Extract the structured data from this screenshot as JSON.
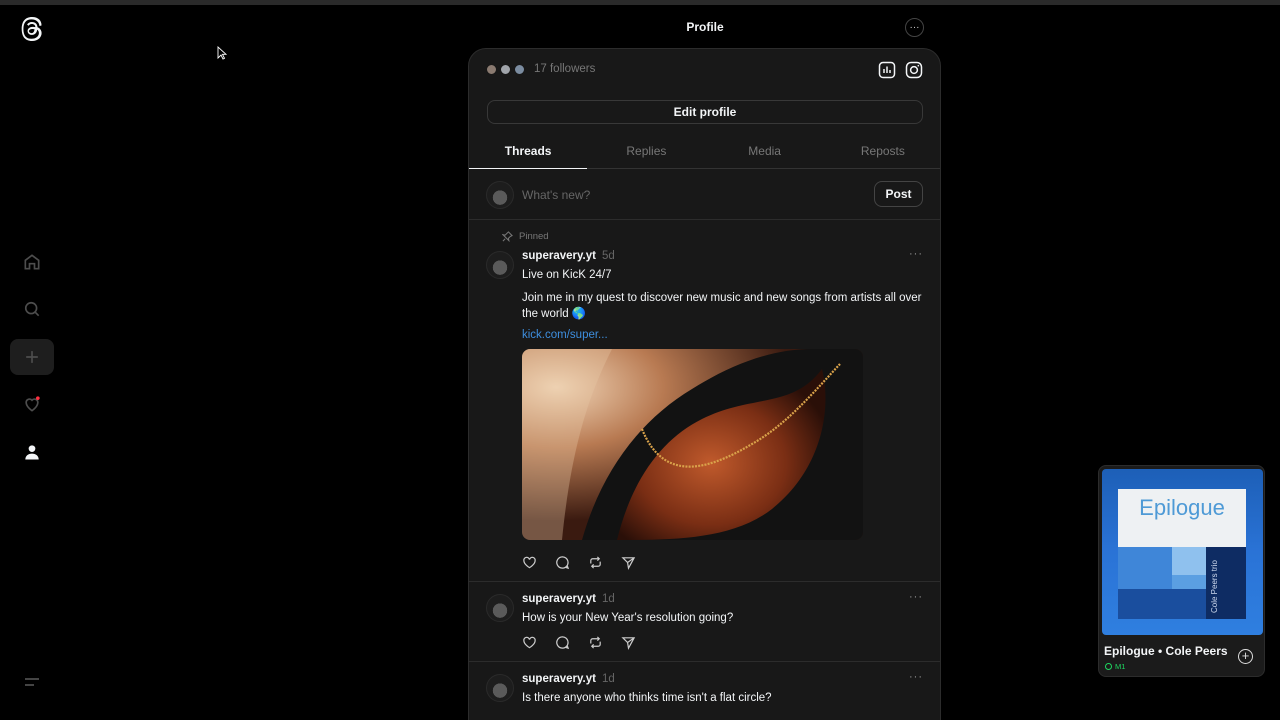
{
  "header": {
    "title": "Profile",
    "more_icon": "more-horizontal-icon",
    "more_label": "···"
  },
  "nav": {
    "logo_icon": "threads-logo-icon",
    "items": [
      {
        "name": "home",
        "icon": "home-icon"
      },
      {
        "name": "search",
        "icon": "search-icon"
      },
      {
        "name": "create",
        "icon": "plus-icon"
      },
      {
        "name": "activity",
        "icon": "heart-icon",
        "notification_dot_color": "#ff3040"
      },
      {
        "name": "profile",
        "icon": "person-icon"
      }
    ],
    "menu_icon": "menu-lines-icon"
  },
  "profile": {
    "followers_text": "17 followers",
    "insights_icon": "bar-chart-icon",
    "instagram_icon": "instagram-icon",
    "edit_profile_label": "Edit profile"
  },
  "tabs": [
    {
      "label": "Threads",
      "active": true
    },
    {
      "label": "Replies",
      "active": false
    },
    {
      "label": "Media",
      "active": false
    },
    {
      "label": "Reposts",
      "active": false
    }
  ],
  "composer": {
    "placeholder": "What's new?",
    "post_label": "Post"
  },
  "posts": [
    {
      "pinned_label": "Pinned",
      "username": "superavery.yt",
      "time": "5d",
      "text_1": "Live on KicK 24/7",
      "text_2": "Join me in my quest to discover new music and new songs from artists all over the world 🌎",
      "link": "kick.com/super...",
      "more": "···"
    },
    {
      "username": "superavery.yt",
      "time": "1d",
      "text_1": "How is your New Year's resolution going?",
      "more": "···"
    },
    {
      "username": "superavery.yt",
      "time": "1d",
      "text_1": "Is there anyone who thinks time isn't a flat circle?",
      "more": "···"
    }
  ],
  "player": {
    "album_title": "Epilogue",
    "album_side_text": "Cole Peers trio",
    "track": "Epilogue • Cole Peers",
    "device": "M1",
    "device_color": "#1ed760",
    "add_icon": "add-circle-icon"
  },
  "colors": {
    "background": "#000000",
    "panel": "#181818",
    "link": "#3e8ede",
    "accent_green": "#1ed760"
  }
}
